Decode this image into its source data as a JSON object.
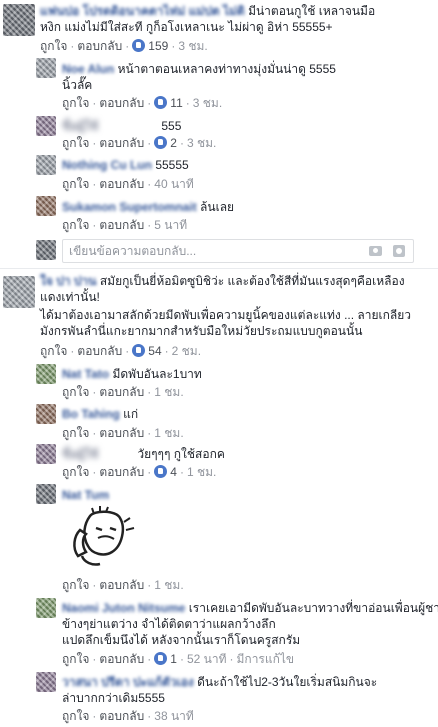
{
  "labels": {
    "like": "ถูกใจ",
    "reply": "ตอบกลับ",
    "edited": "มีการแก้ไข"
  },
  "reply_box": {
    "placeholder": "เขียนข้อความตอบกลับ..."
  },
  "thread1": {
    "comment": {
      "author": "แฟนปอ โปรดดิอนาคตาไห่ม่ แม่ปต ไม่ติ",
      "text_line1": "มีน่าตอนกูใช้ เหลาจนมือ",
      "text_line2": "หงิก แม่งไม่มีใส่สะที กูก็อโงเหลาเนะ ไม่ผ่าดู อิห่า 55555+",
      "likes": "159",
      "time": "3 ชม."
    },
    "replies": [
      {
        "author": "Noe Alun",
        "text": "หน้าตาตอนเหลาคงท่าทางมุ่งมั่นน่าดู 5555",
        "text2": "นิ้วลั๊ค",
        "likes": "11",
        "time": "3 ชม."
      },
      {
        "author": "ชื่อผู้ใช้",
        "text": "555",
        "likes": "2",
        "time": "3 ชม."
      },
      {
        "author": "Nothing Cu Lun",
        "text": "55555",
        "likes": "",
        "time": "40 นาที"
      },
      {
        "author": "Sukamon Supertomnait",
        "text": "ล้นเลย",
        "likes": "",
        "time": "5 นาที"
      }
    ]
  },
  "thread2": {
    "comment": {
      "author": "ใจ ปา ปาน",
      "text_line1": "สมัยกูเป็นยี่ห้อมิตซูบิชิว่ะ และต้องใช้สีที่มันแรงสุดๆคือเหลือง",
      "text_line2": "แดงเท่านั้น!",
      "text_line3": "ได้มาต้องเอามาสลักด้วยมีดพับเพื่อความยูนิ้คของแต่ละแท่ง ... ลายเกลียว",
      "text_line4": "มังกรพันลำนี่แกะยากมากสำหรับมือใหม่วัยประถมแบบกูตอนนั้น",
      "likes": "54",
      "time": "2 ชม."
    },
    "replies": [
      {
        "author": "Nat Tato",
        "text": "มีดพับอันละ1บาท",
        "likes": "",
        "time": "1 ชม."
      },
      {
        "author": "Bo Tahing",
        "text": "แก่",
        "likes": "",
        "time": "1 ชม."
      },
      {
        "author": "ชื่อผู้ใช้",
        "text": "วัยๆๆๆ กูใช้สอกค",
        "likes": "4",
        "time": "1 ชม."
      },
      {
        "author": "Nat Tum",
        "text": "",
        "likes": "",
        "time": "1 ชม."
      },
      {
        "author": "Naomi Juton Nitsume",
        "text": "เราเคยเอามีดพับอันละบาทวางที่ขาอ่อนเพื่อนผู้ชาย",
        "text2": "ข้างๆย่าแตว่าง จำได้ติดตาว่าแผลกว้างลึก",
        "text3": "แปดลึกเข็มนึงได้ หลังจากนั้นเราก็โดนครูสกรัม",
        "likes": "1",
        "time": "52 นาที"
      },
      {
        "author": "วาสนา ปรีดา ปะแก้ตัวเอง",
        "text": "ดีนะถ้าใช้ไป2-3วันใยเริ่มสนิมกินจะ",
        "text2": "ล่าบากกว่าเดิม5555",
        "likes": "",
        "time": "38 นาที"
      }
    ]
  }
}
